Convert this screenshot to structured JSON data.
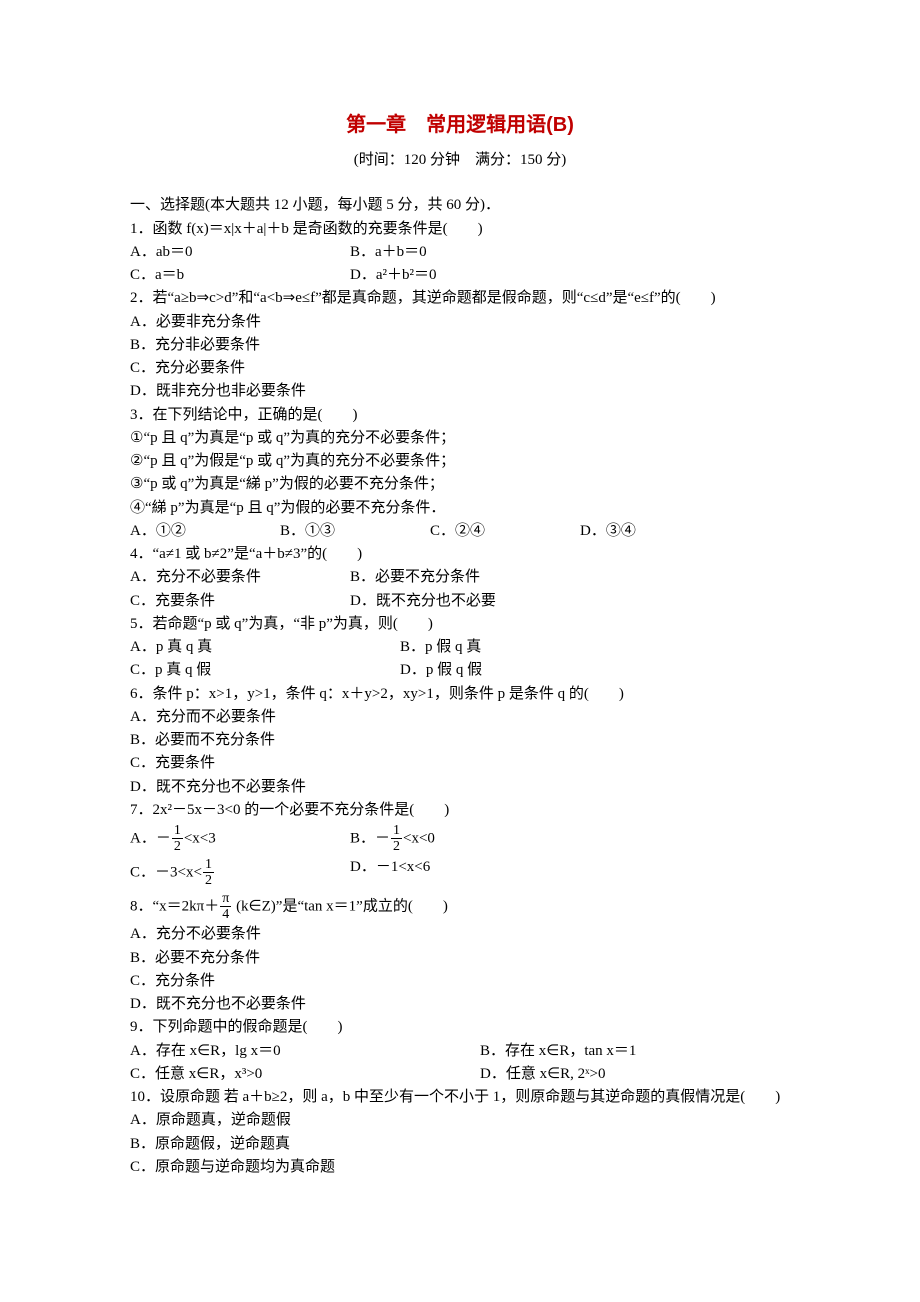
{
  "title": "第一章　常用逻辑用语(B)",
  "subtitle": "(时间：120 分钟　满分：150 分)",
  "section1": "一、选择题(本大题共 12 小题，每小题 5 分，共 60 分)．",
  "q1": "1．函数 f(x)＝x|x＋a|＋b 是奇函数的充要条件是(　　)",
  "q1a": "A．ab＝0",
  "q1b": "B．a＋b＝0",
  "q1c": "C．a＝b",
  "q1d": "D．a²＋b²＝0",
  "q2": "2．若“a≥b⇒c>d”和“a<b⇒e≤f”都是真命题，其逆命题都是假命题，则“c≤d”是“e≤f”的(　　)",
  "q2a": "A．必要非充分条件",
  "q2b": "B．充分非必要条件",
  "q2c": "C．充分必要条件",
  "q2d": "D．既非充分也非必要条件",
  "q3": "3．在下列结论中，正确的是(　　)",
  "q3s1": "①“p 且 q”为真是“p 或 q”为真的充分不必要条件；",
  "q3s2": "②“p 且 q”为假是“p 或 q”为真的充分不必要条件；",
  "q3s3": "③“p 或 q”为真是“綈 p”为假的必要不充分条件；",
  "q3s4": "④“綈 p”为真是“p 且 q”为假的必要不充分条件．",
  "q3a": "A．①②",
  "q3b": "B．①③",
  "q3c": "C．②④",
  "q3d": "D．③④",
  "q4": "4．“a≠1 或 b≠2”是“a＋b≠3”的(　　)",
  "q4a": "A．充分不必要条件",
  "q4b": "B．必要不充分条件",
  "q4c": "C．充要条件",
  "q4d": "D．既不充分也不必要",
  "q5": "5．若命题“p 或 q”为真，“非 p”为真，则(　　)",
  "q5a": "A．p 真 q 真",
  "q5b": "B．p 假 q 真",
  "q5c": "C．p 真 q 假",
  "q5d": "D．p 假 q 假",
  "q6": "6．条件 p：x>1，y>1，条件 q：x＋y>2，xy>1，则条件 p 是条件 q 的(　　)",
  "q6a": "A．充分而不必要条件",
  "q6b": "B．必要而不充分条件",
  "q6c": "C．充要条件",
  "q6d": "D．既不充分也不必要条件",
  "q7": "7．2x²－5x－3<0 的一个必要不充分条件是(　　)",
  "q7a_pre": "A．－",
  "q7a_post": "<x<3",
  "q7b_pre": "B．－",
  "q7b_post": "<x<0",
  "q7c_pre": "C．－3<x<",
  "q7c_post": "",
  "q7d": "D．－1<x<6",
  "q8_pre": "8．“x＝2kπ＋",
  "q8_post": " (k∈Z)”是“tan x＝1”成立的(　　)",
  "q8a": "A．充分不必要条件",
  "q8b": "B．必要不充分条件",
  "q8c": "C．充分条件",
  "q8d": "D．既不充分也不必要条件",
  "q9": "9．下列命题中的假命题是(　　)",
  "q9a": "A．存在 x∈R，lg x＝0",
  "q9b": "B．存在 x∈R，tan x＝1",
  "q9c": "C．任意 x∈R，x³>0",
  "q9d": "D．任意 x∈R, 2ˣ>0",
  "q10": "10．设原命题 若 a＋b≥2，则 a，b 中至少有一个不小于 1，则原命题与其逆命题的真假情况是(　　)",
  "q10a": "A．原命题真，逆命题假",
  "q10b": "B．原命题假，逆命题真",
  "q10c": "C．原命题与逆命题均为真命题"
}
